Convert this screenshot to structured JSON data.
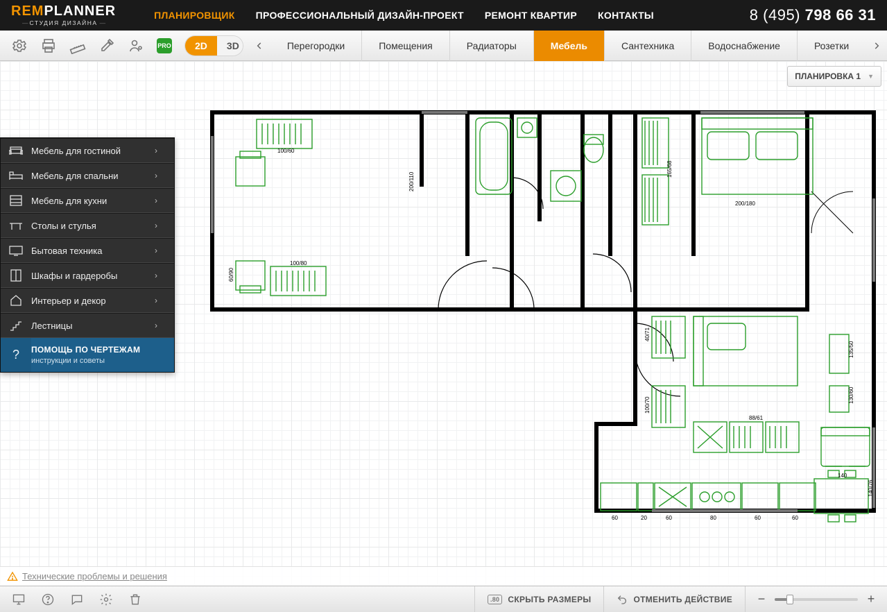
{
  "brand": {
    "rem": "REM",
    "planner": "PLANNER",
    "sub": "СТУДИЯ ДИЗАЙНА"
  },
  "topnav": [
    {
      "label": "ПЛАНИРОВЩИК",
      "active": true
    },
    {
      "label": "ПРОФЕССИОНАЛЬНЫЙ ДИЗАЙН-ПРОЕКТ"
    },
    {
      "label": "РЕМОНТ КВАРТИР"
    },
    {
      "label": "КОНТАКТЫ"
    }
  ],
  "phone": {
    "prefix": "8 (495) ",
    "number": "798 66 31"
  },
  "pro": "PRO",
  "view": {
    "d2": "2D",
    "d3": "3D"
  },
  "tabs": [
    {
      "label": "Перегородки"
    },
    {
      "label": "Помещения"
    },
    {
      "label": "Радиаторы"
    },
    {
      "label": "Мебель",
      "active": true
    },
    {
      "label": "Сантехника"
    },
    {
      "label": "Водоснабжение"
    },
    {
      "label": "Розетки"
    }
  ],
  "plan_dropdown": "ПЛАНИРОВКА 1",
  "sidebar": [
    {
      "label": "Мебель для гостиной",
      "icon": "sofa"
    },
    {
      "label": "Мебель для спальни",
      "icon": "bed"
    },
    {
      "label": "Мебель для кухни",
      "icon": "drawers"
    },
    {
      "label": "Столы и стулья",
      "icon": "table"
    },
    {
      "label": "Бытовая техника",
      "icon": "tv"
    },
    {
      "label": "Шкафы и гардеробы",
      "icon": "wardrobe"
    },
    {
      "label": "Интерьер и декор",
      "icon": "home"
    },
    {
      "label": "Лестницы",
      "icon": "stairs"
    }
  ],
  "help": {
    "title": "ПОМОЩЬ ПО ЧЕРТЕЖАМ",
    "sub": "инструкции и советы",
    "q": "?"
  },
  "tech_link": "Технические проблемы и решения",
  "footer": {
    "hide_sizes": "СКРЫТЬ РАЗМЕРЫ",
    "undo": "ОТМЕНИТЬ ДЕЙСТВИЕ",
    "size_badge": ".80"
  },
  "dimensions": {
    "d1": "100/60",
    "d2": "200/110",
    "d3": "100/80",
    "d4": "60/90",
    "d5": "165/68",
    "d6": "200/180",
    "d7": "40/71",
    "d8": "100/70",
    "d9": "135/50",
    "d10": "130/60",
    "d11": "88/61",
    "d12": "140",
    "d13": "60",
    "d14": "20",
    "d15": "60",
    "d16": "80",
    "d17": "60",
    "d18": "60",
    "d19": "140/76"
  }
}
